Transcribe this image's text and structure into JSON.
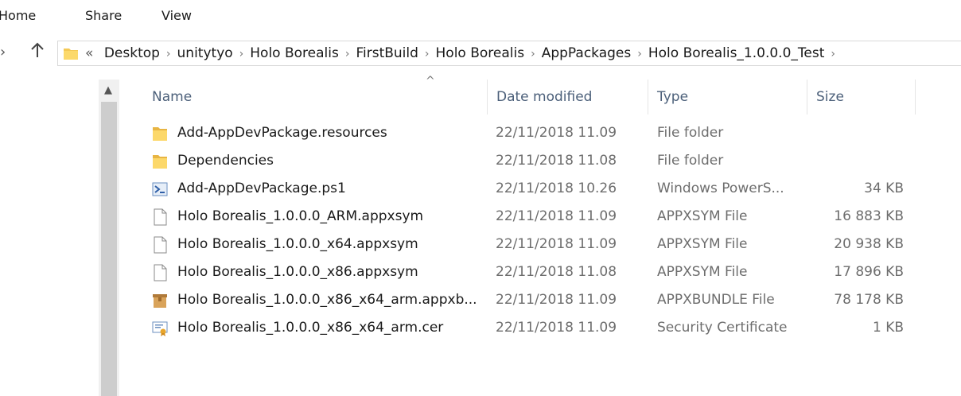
{
  "ribbon": {
    "tabs": [
      "Home",
      "Share",
      "View"
    ]
  },
  "address": {
    "overflow": "«",
    "crumbs": [
      "Desktop",
      "unitytyo",
      "Holo Borealis",
      "FirstBuild",
      "Holo Borealis",
      "AppPackages",
      "Holo Borealis_1.0.0.0_Test"
    ]
  },
  "columns": {
    "name": "Name",
    "date": "Date modified",
    "type": "Type",
    "size": "Size"
  },
  "files": [
    {
      "icon": "folder-icon",
      "name": "Add-AppDevPackage.resources",
      "date": "22/11/2018 11.09",
      "type": "File folder",
      "size": ""
    },
    {
      "icon": "folder-icon",
      "name": "Dependencies",
      "date": "22/11/2018 11.08",
      "type": "File folder",
      "size": ""
    },
    {
      "icon": "powershell-script-icon",
      "name": "Add-AppDevPackage.ps1",
      "date": "22/11/2018 10.26",
      "type": "Windows PowerS...",
      "size": "34 KB"
    },
    {
      "icon": "file-icon",
      "name": "Holo Borealis_1.0.0.0_ARM.appxsym",
      "date": "22/11/2018 11.09",
      "type": "APPXSYM File",
      "size": "16 883 KB"
    },
    {
      "icon": "file-icon",
      "name": "Holo Borealis_1.0.0.0_x64.appxsym",
      "date": "22/11/2018 11.09",
      "type": "APPXSYM File",
      "size": "20 938 KB"
    },
    {
      "icon": "file-icon",
      "name": "Holo Borealis_1.0.0.0_x86.appxsym",
      "date": "22/11/2018 11.08",
      "type": "APPXSYM File",
      "size": "17 896 KB"
    },
    {
      "icon": "package-box-icon",
      "name": "Holo Borealis_1.0.0.0_x86_x64_arm.appxb...",
      "date": "22/11/2018 11.09",
      "type": "APPXBUNDLE File",
      "size": "78 178 KB"
    },
    {
      "icon": "certificate-icon",
      "name": "Holo Borealis_1.0.0.0_x86_x64_arm.cer",
      "date": "22/11/2018 11.09",
      "type": "Security Certificate",
      "size": "1 KB"
    }
  ]
}
